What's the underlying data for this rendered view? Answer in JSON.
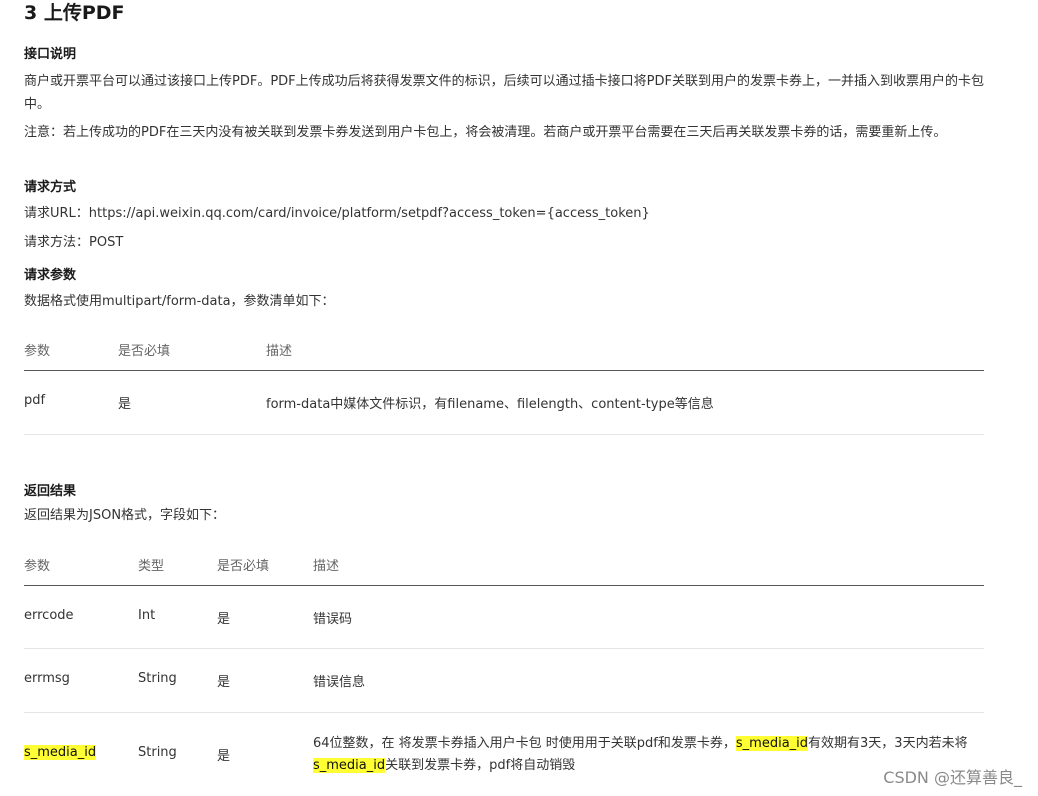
{
  "section_title": "3 上传PDF",
  "intro": {
    "heading": "接口说明",
    "para1": "商户或开票平台可以通过该接口上传PDF。PDF上传成功后将获得发票文件的标识，后续可以通过插卡接口将PDF关联到用户的发票卡券上，一并插入到收票用户的卡包中。",
    "para2": "注意：若上传成功的PDF在三天内没有被关联到发票卡券发送到用户卡包上，将会被清理。若商户或开票平台需要在三天后再关联发票卡券的话，需要重新上传。"
  },
  "request": {
    "heading": "请求方式",
    "url_line": "请求URL：https://api.weixin.qq.com/card/invoice/platform/setpdf?access_token={access_token}",
    "method_line": "请求方法：POST"
  },
  "params": {
    "heading": "请求参数",
    "desc": "数据格式使用multipart/form-data，参数清单如下：",
    "columns": [
      "参数",
      "是否必填",
      "描述"
    ],
    "rows": [
      [
        "pdf",
        "是",
        "form-data中媒体文件标识，有filename、filelength、content-type等信息"
      ]
    ]
  },
  "result": {
    "heading": "返回结果",
    "desc": "返回结果为JSON格式，字段如下：",
    "columns": [
      "参数",
      "类型",
      "是否必填",
      "描述"
    ],
    "rows": [
      [
        "errcode",
        "Int",
        "是",
        "错误码"
      ],
      [
        "errmsg",
        "String",
        "是",
        "错误信息"
      ]
    ],
    "last_row": {
      "name": "s_media_id",
      "type": "String",
      "required": "是",
      "desc_a": "64位整数，在 将发票卡券插入用户卡包 时使用用于关联pdf和发票卡券，",
      "desc_b": "s_media_id",
      "desc_c": "有效期有3天，3天内若未将",
      "desc_d": "s_media_id",
      "desc_e": "关联到发票卡券，pdf将自动销毁"
    }
  },
  "watermark": "CSDN @还算善良_",
  "colors": {
    "highlight": "#ffff33",
    "text": "#333333",
    "header_text": "#666666",
    "rule_dark": "#555555",
    "rule_light": "#e6e6e6"
  }
}
